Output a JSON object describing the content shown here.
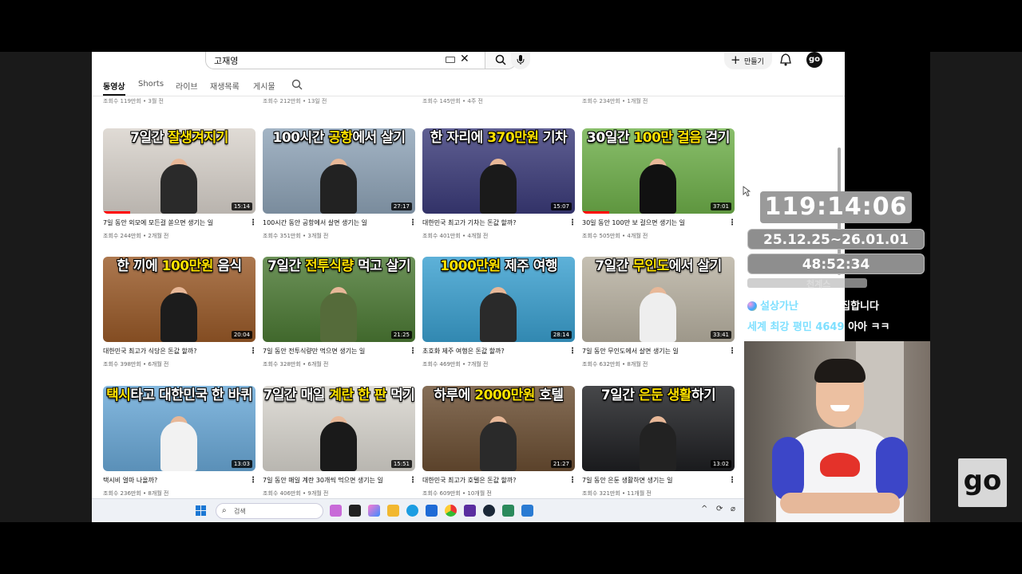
{
  "header": {
    "search_value": "고재영",
    "create_label": "만들기",
    "avatar_label": "go"
  },
  "tabs": [
    "동영상",
    "Shorts",
    "라이브",
    "재생목록",
    "게시물"
  ],
  "prev_row_meta": [
    "조회수 119만회 • 3월 전",
    "조회수 212만회 • 13일 전",
    "조회수 145만회 • 4주 전",
    "조회수 234만회 • 1개월 전"
  ],
  "videos": [
    {
      "thumb_pre": "7일간 ",
      "thumb_hl": "잘생겨지기",
      "thumb_post": "",
      "duration": "15:14",
      "title": "7일 동안 외모에 모든걸 쏟으면 생기는 일",
      "meta": "조회수 244만회 • 2개월 전",
      "bg": "#d9d3cc",
      "person": "#2a2a2a"
    },
    {
      "thumb_pre": "100시간 ",
      "thumb_hl": "공항",
      "thumb_post": "에서 살기",
      "duration": "27:17",
      "title": "100시간 동안 공항에서 살면 생기는 일",
      "meta": "조회수 351만회 • 3개월 전",
      "bg": "#8fa4b8",
      "person": "#222"
    },
    {
      "thumb_pre": "한 자리에 ",
      "thumb_hl": "370만원",
      "thumb_post": " 기차",
      "duration": "15:07",
      "title": "대한민국 최고가 기차는 돈값 할까?",
      "meta": "조회수 401만회 • 4개월 전",
      "bg": "#3b3b7a",
      "person": "#1a1a1a"
    },
    {
      "thumb_pre": "30일간 ",
      "thumb_hl": "100만 걸음",
      "thumb_post": " 걷기",
      "duration": "37:01",
      "title": "30일 동안 100만 보 걸으면 생기는 일",
      "meta": "조회수 505만회 • 4개월 전",
      "bg": "#6fb04a",
      "person": "#111"
    },
    {
      "thumb_pre": "한 끼에 ",
      "thumb_hl": "100만원",
      "thumb_post": " 음식",
      "duration": "20:04",
      "title": "대한민국 최고가 식당은 돈값 할까?",
      "meta": "조회수 398만회 • 6개월 전",
      "bg": "#9a5a28",
      "person": "#1c1c1c"
    },
    {
      "thumb_pre": "7일간 ",
      "thumb_hl": "전투식량",
      "thumb_post": " 먹고 살기",
      "duration": "21:25",
      "title": "7일 동안 전투식량만 먹으면 생기는 일",
      "meta": "조회수 328만회 • 6개월 전",
      "bg": "#4c7a34",
      "person": "#556b3a"
    },
    {
      "thumb_pre": "",
      "thumb_hl": "1000만원",
      "thumb_post": " 제주 여행",
      "duration": "28:14",
      "title": "초호화 제주 여행은 돈값 할까?",
      "meta": "조회수 469만회 • 7개월 전",
      "bg": "#3aa0d0",
      "person": "#2a2a2a"
    },
    {
      "thumb_pre": "7일간 ",
      "thumb_hl": "무인도",
      "thumb_post": "에서 살기",
      "duration": "33:41",
      "title": "7일 동안 무인도에서 살면 생기는 일",
      "meta": "조회수 632만회 • 8개월 전",
      "bg": "#b9b2a2",
      "person": "#eee"
    },
    {
      "thumb_pre": "",
      "thumb_hl": "택시",
      "thumb_post": "타고 대한민국 한 바퀴",
      "duration": "13:03",
      "title": "택시비 얼마 나올까?",
      "meta": "조회수 236만회 • 8개월 전",
      "bg": "#6aa9d8",
      "person": "#f2f2f2"
    },
    {
      "thumb_pre": "7일간 매일 ",
      "thumb_hl": "계란 한 판",
      "thumb_post": " 먹기",
      "duration": "15:51",
      "title": "7일 동안 매일 계란 30개씩 먹으면 생기는 일",
      "meta": "조회수 406만회 • 9개월 전",
      "bg": "#d9d6cf",
      "person": "#1a1a1a"
    },
    {
      "thumb_pre": "하루에 ",
      "thumb_hl": "2000만원",
      "thumb_post": " 호텔",
      "duration": "21:27",
      "title": "대한민국 최고가 호텔은 돈값 할까?",
      "meta": "조회수 609만회 • 10개월 전",
      "bg": "#6b4e32",
      "person": "#2a2a2a"
    },
    {
      "thumb_pre": "7일간 ",
      "thumb_hl": "은둔 생활",
      "thumb_post": "하기",
      "duration": "13:02",
      "title": "7일 동안 은둔 생활하면 생기는 일",
      "meta": "조회수 321만회 • 11개월 전",
      "bg": "#1e1f22",
      "person": "#222"
    }
  ],
  "taskbar": {
    "search_label": "검색"
  },
  "overlay": {
    "timer": "119:14:06",
    "date_range": "25.12.25~26.01.01",
    "subtimer": "48:52:34",
    "smear_text": "천계스",
    "chat1_nick": "설상가난",
    "chat1_msg": "PD랑 편집합니다",
    "chat2_nick": "세계 최강 평민 4649",
    "chat2_msg": "아아 ㅋㅋ"
  },
  "badge": "go",
  "colors": {
    "accent": "#ff0000",
    "highlight": "#ffe200",
    "overlay_grey": "#9a9a9a"
  }
}
